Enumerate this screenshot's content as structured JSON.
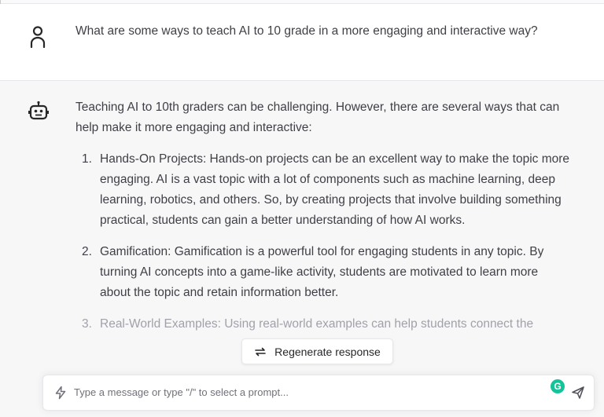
{
  "conversation": {
    "user_message": {
      "avatar_icon": "user-icon",
      "text": "What are some ways to teach AI to 10 grade in a more engaging and interactive way?"
    },
    "assistant_message": {
      "avatar_icon": "robot-icon",
      "intro": "Teaching AI to 10th graders can be challenging. However, there are several ways that can help make it more engaging and interactive:",
      "items": [
        {
          "number": "1.",
          "text": "Hands-On Projects: Hands-on projects can be an excellent way to make the topic more engaging. AI is a vast topic with a lot of components such as machine learning, deep learning, robotics, and others. So, by creating projects that involve building something practical, students can gain a better understanding of how AI works."
        },
        {
          "number": "2.",
          "text": "Gamification: Gamification is a powerful tool for engaging students in any topic. By turning AI concepts into a game-like activity, students are motivated to learn more about the topic and retain information better."
        },
        {
          "number": "3.",
          "text": "Real-World Examples: Using real-world examples can help students connect the"
        }
      ]
    }
  },
  "regenerate": {
    "label": "Regenerate response",
    "icon": "refresh-icon"
  },
  "composer": {
    "placeholder": "Type a message or type \"/\" to select a prompt...",
    "prompt_icon": "bolt-icon",
    "grammarly_badge": "G",
    "send_icon": "send-icon"
  },
  "colors": {
    "assistant_bg": "#f7f7f8",
    "grammarly": "#15c39a",
    "text": "#3f3f46"
  }
}
